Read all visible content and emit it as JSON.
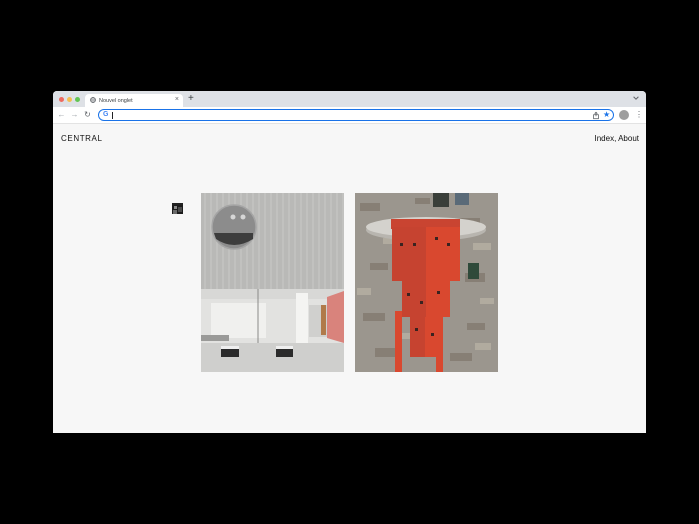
{
  "browser": {
    "tab_title": "Nouvel onglet",
    "tab_close": "×",
    "new_tab": "+",
    "back": "←",
    "forward": "→",
    "reload": "↻",
    "omnibox_icon": "G",
    "bookmark": "★",
    "menu": "⋮"
  },
  "site": {
    "brand": "CENTRAL",
    "nav": {
      "index": "Index",
      "separator": ", ",
      "about": "About"
    }
  },
  "icons": {
    "tab_favicon": "globe-icon",
    "share": "share-icon",
    "star": "star-icon",
    "tab_menu": "chevron-down-icon"
  },
  "colors": {
    "page_background": "#f7f7f7",
    "omnibox_focus": "#1a73e8",
    "sculpture_red": "#d9482f"
  }
}
